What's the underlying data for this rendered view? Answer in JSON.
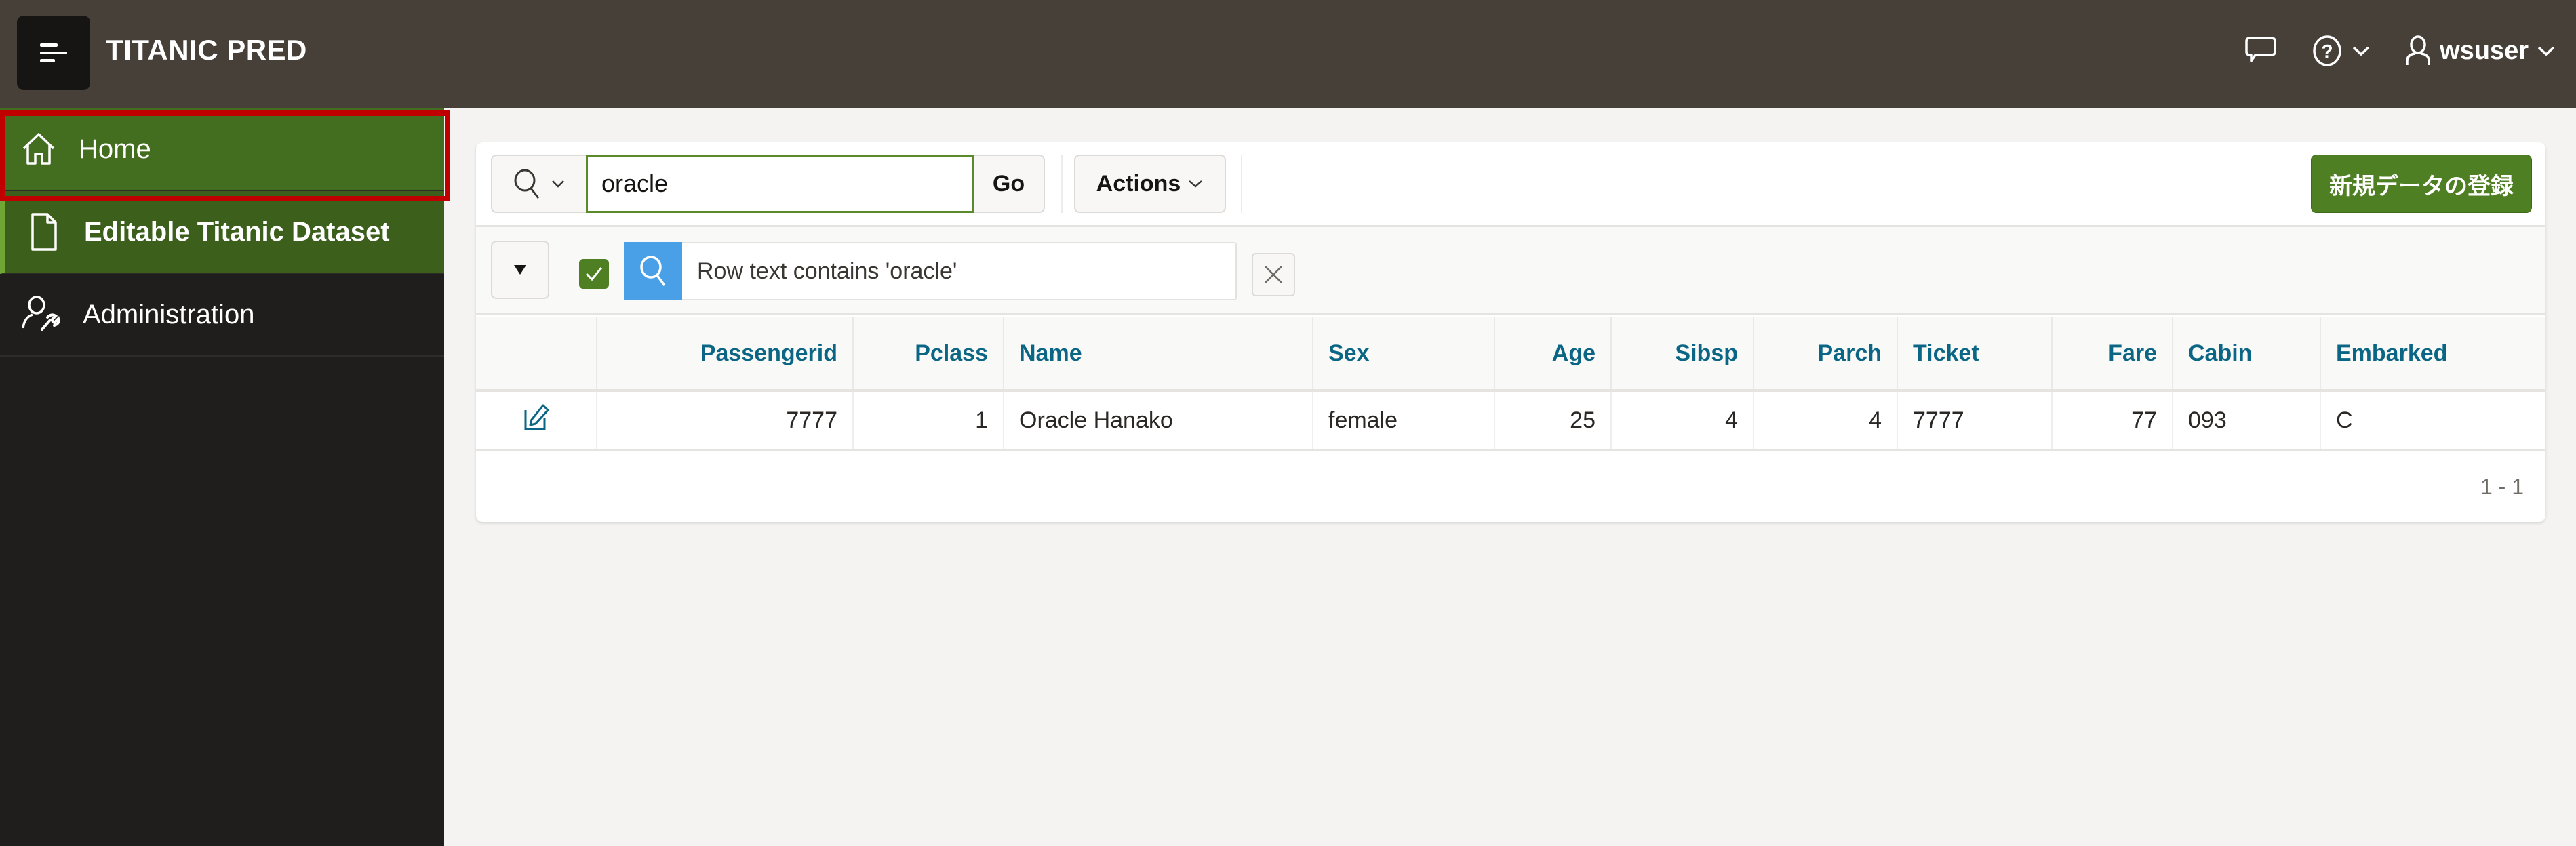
{
  "header": {
    "app_title": "TITANIC PRED",
    "user_name": "wsuser",
    "icons": {
      "nav_toggle": "hamburger-menu-icon",
      "feedback": "speech-bubble-icon",
      "help": "question-circle-icon",
      "user": "user-icon"
    }
  },
  "sidebar": {
    "items": [
      {
        "label": "Home",
        "icon": "home-icon",
        "state": "highlighted"
      },
      {
        "label": "Editable Titanic Dataset",
        "icon": "document-icon",
        "state": "current"
      },
      {
        "label": "Administration",
        "icon": "user-wrench-icon",
        "state": "normal"
      }
    ]
  },
  "toolbar": {
    "search_value": "oracle",
    "search_placeholder": "",
    "go_label": "Go",
    "actions_label": "Actions",
    "create_label": "新規データの登録"
  },
  "filter": {
    "text": "Row text contains 'oracle'",
    "enabled": true
  },
  "report": {
    "columns": [
      "",
      "Passengerid",
      "Pclass",
      "Name",
      "Sex",
      "Age",
      "Sibsp",
      "Parch",
      "Ticket",
      "Fare",
      "Cabin",
      "Embarked"
    ],
    "rows": [
      [
        "edit",
        "7777",
        "1",
        "Oracle Hanako",
        "female",
        "25",
        "4",
        "4",
        "7777",
        "77",
        "093",
        "C"
      ]
    ],
    "pagination": "1 - 1"
  },
  "colors": {
    "header_bg": "#464039",
    "sidebar_bg": "#201e1c",
    "active_green": "#4f7f23",
    "highlight_red": "#c00000",
    "column_header_text": "#0a6684",
    "filter_icon_bg": "#4aa0e6"
  }
}
